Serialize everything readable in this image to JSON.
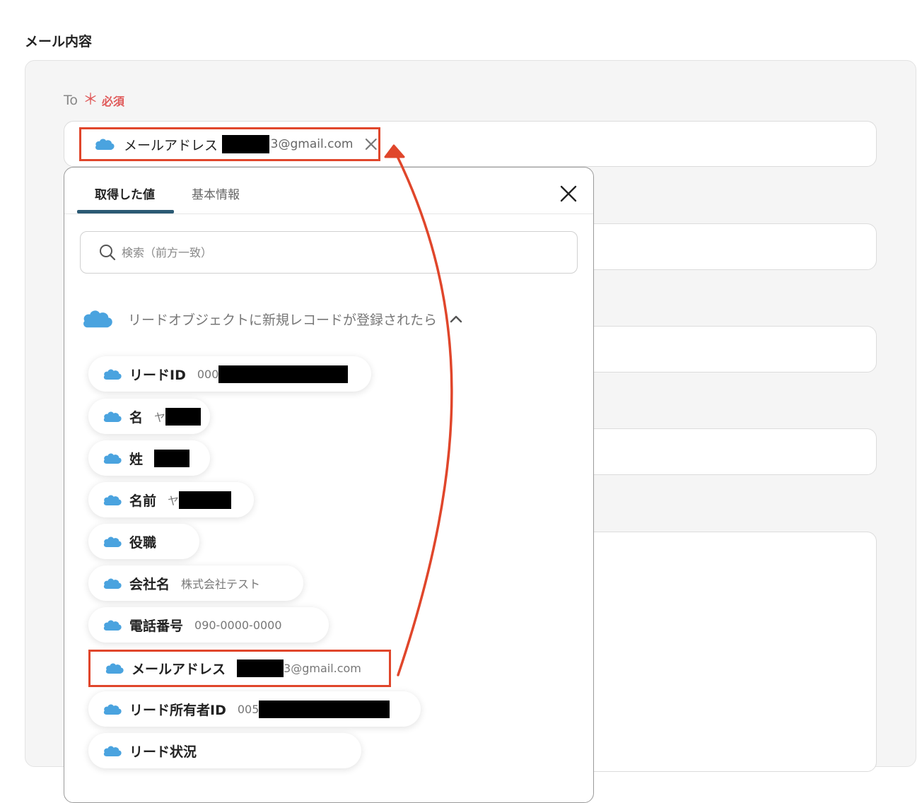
{
  "section_title": "メール内容",
  "to_field": {
    "label": "To",
    "required_mark": "＊",
    "required_text": "必須",
    "chip": {
      "label": "メールアドレス",
      "email_suffix": "3@gmail.com",
      "close_icon": "close-icon"
    }
  },
  "dropdown": {
    "tabs": [
      {
        "label": "取得した値",
        "active": true
      },
      {
        "label": "基本情報",
        "active": false
      }
    ],
    "search_placeholder": "検索（前方一致）",
    "group": {
      "title": "リードオブジェクトに新規レコードが登録されたら",
      "expanded": true
    },
    "items": [
      {
        "label": "リードID",
        "value": "000"
      },
      {
        "label": "名",
        "value": "ヤ"
      },
      {
        "label": "姓",
        "value": ""
      },
      {
        "label": "名前",
        "value": "ヤ"
      },
      {
        "label": "役職",
        "value": ""
      },
      {
        "label": "会社名",
        "value": "株式会社テスト"
      },
      {
        "label": "電話番号",
        "value": "090-0000-0000"
      },
      {
        "label": "メールアドレス",
        "value": "3@gmail.com"
      },
      {
        "label": "リード所有者ID",
        "value": "005"
      },
      {
        "label": "リード状況",
        "value": ""
      }
    ]
  },
  "colors": {
    "salesforce_blue": "#4aa3df",
    "highlight_red": "#e0462b",
    "required_red": "#e05a5a",
    "tab_underline": "#2b5a74"
  }
}
